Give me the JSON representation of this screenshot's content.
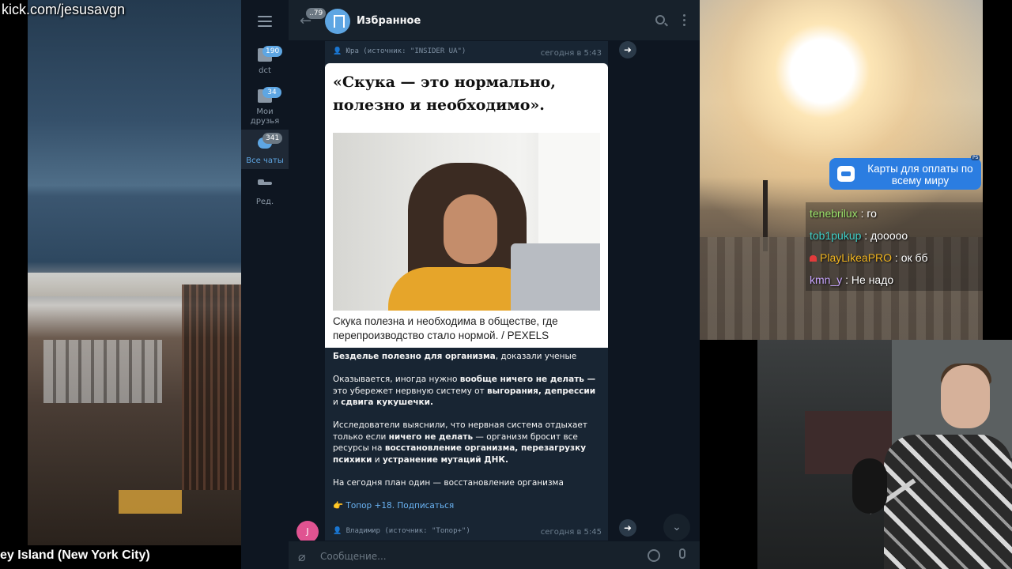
{
  "stream": {
    "url": "kick.com/jesusavgn",
    "caption": "ey Island (New York City)"
  },
  "telegram": {
    "folders": [
      {
        "label": "dct",
        "badge": "190",
        "active": false
      },
      {
        "label": "Мои друзья",
        "badge": "34",
        "active": false
      },
      {
        "label": "Все чаты",
        "badge": "341",
        "active": true
      },
      {
        "label": "Ред.",
        "badge": "",
        "active": false
      }
    ],
    "header": {
      "unread_count": "..79",
      "chat_title": "Избранное"
    },
    "message": {
      "forwarded_from": "Юра (источник: \"INSIDER UA\")",
      "time": "сегодня в 5:43",
      "headline": "«Скука — это нормально, полезно и необходимо».",
      "photo_caption": "Скука полезна и необходима в обществе, где перепроизводство стало нормой. / PEXELS",
      "p1_bold": "Безделье полезно для организма",
      "p1_rest": ", доказали ученые",
      "p2_a": "Оказывается, иногда нужно ",
      "p2_b": "вообще ничего не делать —",
      "p2_c": " это убережет нервную систему от ",
      "p2_d": "выгорания, депрессии",
      "p2_e": " и ",
      "p2_f": "сдвига кукушечки.",
      "p3_a": "Исследователи выяснили, что нервная система отдыхает только если ",
      "p3_b": "ничего не делать",
      "p3_c": " — организм бросит все ресурсы на ",
      "p3_d": "восстановление организма, перезагрузку психики",
      "p3_e": " и ",
      "p3_f": "устранение мутаций ДНК.",
      "p4": "На сегодня план один — восстановление организма",
      "p5_emoji": "👉",
      "p5_link": " Топор +18. Подписаться"
    },
    "message2": {
      "avatar_letter": "J",
      "forwarded_from": "Владимир (источник: \"Топор+\")",
      "time": "сегодня в 5:45"
    },
    "composer": {
      "placeholder": "Сообщение..."
    }
  },
  "promo": {
    "text": "Карты для оплаты по всему миру",
    "badge": "PS"
  },
  "live_chat": [
    {
      "user": "tenebrilux",
      "message": "го",
      "color": "#9be36b"
    },
    {
      "user": "tob1pukup",
      "message": "дооооо",
      "color": "#3fd0c8"
    },
    {
      "user": "PlayLikeaPRO",
      "message": "ок бб",
      "color": "#f2b51f"
    },
    {
      "user": "kmn_y",
      "message": "Не надо",
      "color": "#c9a6ff"
    }
  ]
}
